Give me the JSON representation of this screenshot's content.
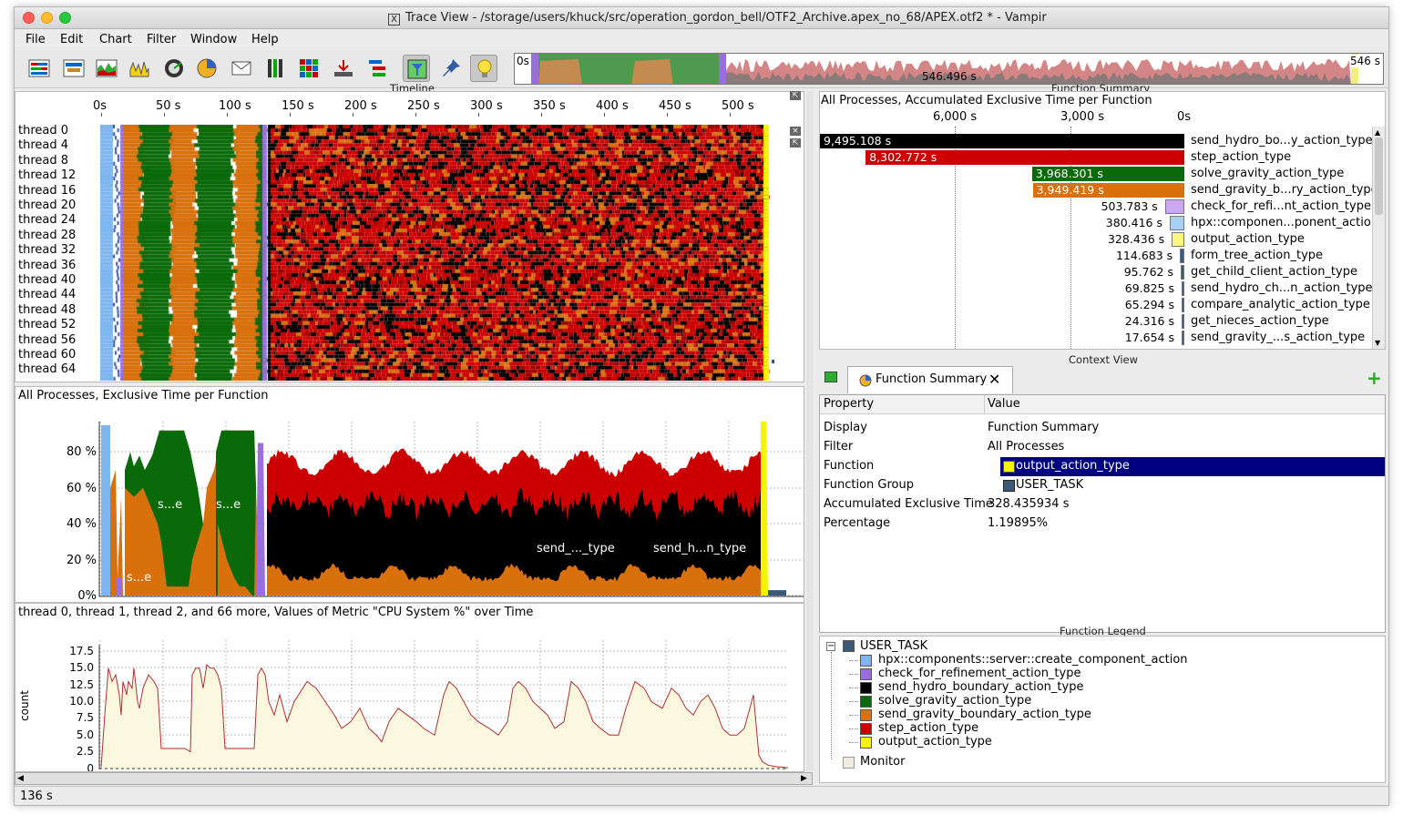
{
  "window": {
    "title": "Trace View - /storage/users/khuck/src/operation_gordon_bell/OTF2_Archive.apex_no_68/APEX.otf2 * - Vampir"
  },
  "menu": [
    "File",
    "Edit",
    "Chart",
    "Filter",
    "Window",
    "Help"
  ],
  "toolbar": {
    "icons": [
      "master-timeline-icon",
      "process-timeline-icon",
      "summary-timeline-icon",
      "counter-timeline-icon",
      "performance-radar-icon",
      "function-summary-icon",
      "message-summary-icon",
      "process-summary-icon",
      "communication-matrix-icon",
      "io-summary-icon",
      "call-tree-icon",
      "filter-icon",
      "pin-icon",
      "lightbulb-icon"
    ],
    "overview_start": "0s",
    "overview_end": "546 s",
    "overview_mid": "546.496 s"
  },
  "colors": {
    "hpx": "#7eb6f0",
    "check": "#9b6ee0",
    "send_hydro": "#000000",
    "solve_gravity": "#0a6a0a",
    "send_gravity": "#d8700c",
    "step": "#cc0000",
    "output": "#f5f500",
    "user_task": "#3a5a7a",
    "selection": "#000080"
  },
  "timeline": {
    "title": "Timeline",
    "axis": [
      "0s",
      "50 s",
      "100 s",
      "150 s",
      "200 s",
      "250 s",
      "300 s",
      "350 s",
      "400 s",
      "450 s",
      "500 s"
    ],
    "threads": [
      "thread 0",
      "thread 4",
      "thread 8",
      "thread 12",
      "thread 16",
      "thread 20",
      "thread 24",
      "thread 28",
      "thread 32",
      "thread 36",
      "thread 40",
      "thread 44",
      "thread 48",
      "thread 52",
      "thread 56",
      "thread 60",
      "thread 64"
    ]
  },
  "exclusive_chart": {
    "title": "All Processes, Exclusive Time per Function",
    "yticks": [
      "80 %",
      "60 %",
      "40 %",
      "20 %",
      "0%"
    ],
    "labels": [
      "s...e",
      "s...e",
      "s...e",
      "send_..._type",
      "send_h...n_type"
    ]
  },
  "metric_chart": {
    "title": "thread 0, thread 1, thread 2, and 66 more, Values of Metric \"CPU System %\" over Time",
    "ylabel": "count",
    "yticks": [
      "17.5",
      "15.0",
      "12.5",
      "10.0",
      "7.5",
      "5.0",
      "2.5",
      "0"
    ]
  },
  "function_summary": {
    "panel_title": "Function Summary",
    "subtitle": "All Processes, Accumulated Exclusive Time per Function",
    "axis": [
      "6,000 s",
      "3,000 s",
      "0s"
    ],
    "rows": [
      {
        "value": "9,495.108 s",
        "name": "send_hydro_bo...y_action_type",
        "seconds": 9495.108,
        "color": "#000000",
        "label_inside": true
      },
      {
        "value": "8,302.772 s",
        "name": "step_action_type",
        "seconds": 8302.772,
        "color": "#cc0000",
        "label_inside": true
      },
      {
        "value": "3,968.301 s",
        "name": "solve_gravity_action_type",
        "seconds": 3968.301,
        "color": "#0a6a0a",
        "label_inside": true
      },
      {
        "value": "3,949.419 s",
        "name": "send_gravity_b...ry_action_type",
        "seconds": 3949.419,
        "color": "#d8700c",
        "label_inside": true
      },
      {
        "value": "503.783 s",
        "name": "check_for_refi...nt_action_type",
        "seconds": 503.783,
        "color": "#c9a8f0",
        "label_inside": false
      },
      {
        "value": "380.416 s",
        "name": "hpx::componen...ponent_action",
        "seconds": 380.416,
        "color": "#a8d0f5",
        "label_inside": false
      },
      {
        "value": "328.436 s",
        "name": "output_action_type",
        "seconds": 328.436,
        "color": "#f8f880",
        "label_inside": false
      },
      {
        "value": "114.683 s",
        "name": "form_tree_action_type",
        "seconds": 114.683,
        "color": "#3a5a7a",
        "label_inside": false
      },
      {
        "value": "95.762 s",
        "name": "get_child_client_action_type",
        "seconds": 95.762,
        "color": "#3a5a7a",
        "label_inside": false
      },
      {
        "value": "69.825 s",
        "name": "send_hydro_ch...n_action_type",
        "seconds": 69.825,
        "color": "#3a5a7a",
        "label_inside": false
      },
      {
        "value": "65.294 s",
        "name": "compare_analytic_action_type",
        "seconds": 65.294,
        "color": "#3a5a7a",
        "label_inside": false
      },
      {
        "value": "24.316 s",
        "name": "get_nieces_action_type",
        "seconds": 24.316,
        "color": "#3a5a7a",
        "label_inside": false
      },
      {
        "value": "17.654 s",
        "name": "send_gravity_...s_action_type",
        "seconds": 17.654,
        "color": "#3a5a7a",
        "label_inside": false
      }
    ]
  },
  "context_view": {
    "panel_title": "Context View",
    "tab": "Function Summary",
    "headers": {
      "property": "Property",
      "value": "Value"
    },
    "rows": [
      {
        "k": "Display",
        "v": "Function Summary"
      },
      {
        "k": "Filter",
        "v": "All Processes"
      },
      {
        "k": "Function",
        "v": "output_action_type"
      },
      {
        "k": "Function Group",
        "v": "USER_TASK"
      },
      {
        "k": "Accumulated Exclusive Time",
        "v": "328.435934 s"
      },
      {
        "k": "Percentage",
        "v": "1.19895%"
      }
    ]
  },
  "legend": {
    "panel_title": "Function Legend",
    "group": "USER_TASK",
    "items": [
      {
        "name": "hpx::components::server::create_component_action",
        "color": "#7eb6f0"
      },
      {
        "name": "check_for_refinement_action_type",
        "color": "#9b6ee0"
      },
      {
        "name": "send_hydro_boundary_action_type",
        "color": "#000000"
      },
      {
        "name": "solve_gravity_action_type",
        "color": "#0a6a0a"
      },
      {
        "name": "send_gravity_boundary_action_type",
        "color": "#d8700c"
      },
      {
        "name": "step_action_type",
        "color": "#cc0000"
      },
      {
        "name": "output_action_type",
        "color": "#f5f500"
      }
    ],
    "monitor": "Monitor"
  },
  "status": {
    "text": "136 s"
  }
}
